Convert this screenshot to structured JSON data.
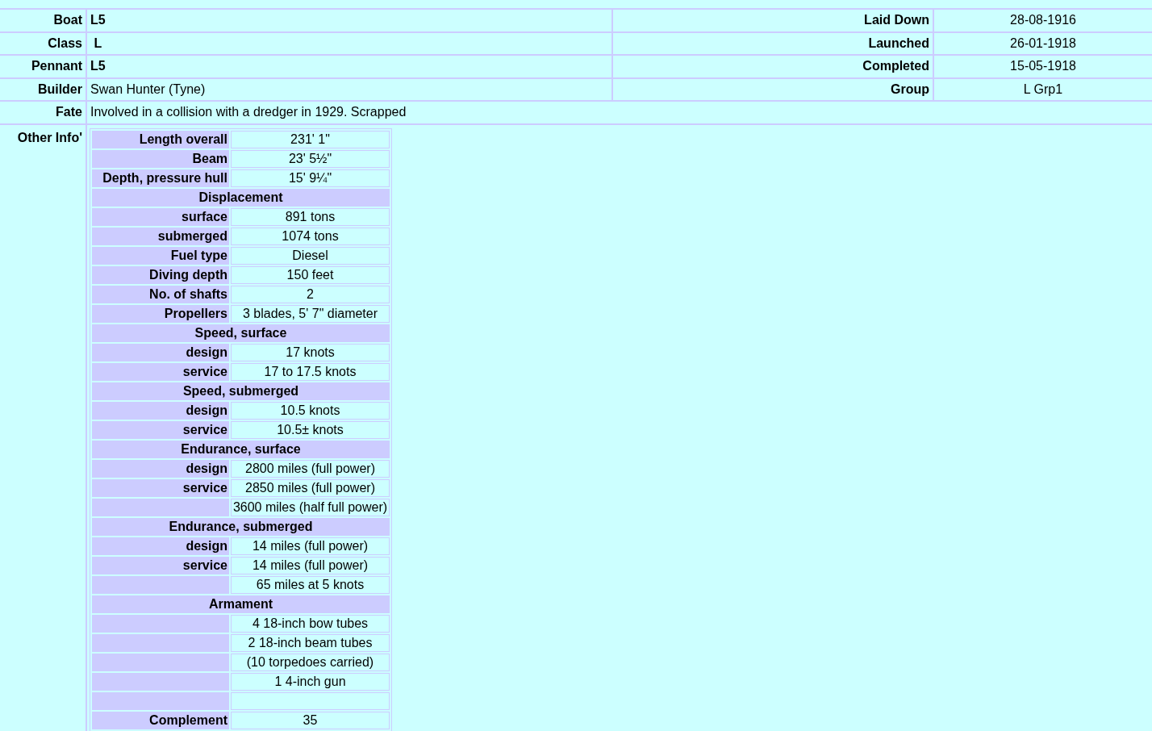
{
  "summary": [
    {
      "label": "Boat",
      "value": "L5",
      "bold": true,
      "label_2": "Laid Down",
      "value_2": "28-08-1916"
    },
    {
      "label": "Class",
      "value": " L",
      "bold": true,
      "label_2": "Launched",
      "value_2": "26-01-1918"
    },
    {
      "label": "Pennant",
      "value": "L5",
      "bold": true,
      "label_2": "Completed",
      "value_2": "15-05-1918"
    },
    {
      "label": "Builder",
      "value": "Swan Hunter (Tyne)",
      "bold": false,
      "label_2": "Group",
      "value_2": "L Grp1"
    }
  ],
  "fate": {
    "label": "Fate",
    "value": "Involved in a collision with a dredger in 1929. Scrapped"
  },
  "other_info": {
    "label": "Other Info'",
    "rows": [
      {
        "kind": "field",
        "label": "Length overall",
        "value": "231' 1\""
      },
      {
        "kind": "field",
        "label": "Beam",
        "value": "23' 5½\""
      },
      {
        "kind": "field",
        "label": "Depth, pressure hull",
        "value": "15' 9¼\""
      },
      {
        "kind": "header",
        "label": "Displacement"
      },
      {
        "kind": "field",
        "label": "surface",
        "value": "891 tons"
      },
      {
        "kind": "field",
        "label": "submerged",
        "value": "1074 tons"
      },
      {
        "kind": "field",
        "label": "Fuel type",
        "value": "Diesel"
      },
      {
        "kind": "field",
        "label": "Diving depth",
        "value": "150 feet"
      },
      {
        "kind": "field",
        "label": "No. of shafts",
        "value": "2"
      },
      {
        "kind": "field",
        "label": "Propellers",
        "value": "3 blades, 5' 7\" diameter"
      },
      {
        "kind": "header",
        "label": "Speed, surface"
      },
      {
        "kind": "field",
        "label": "design",
        "value": "17 knots"
      },
      {
        "kind": "field",
        "label": "service",
        "value": "17 to 17.5 knots"
      },
      {
        "kind": "header",
        "label": "Speed, submerged"
      },
      {
        "kind": "field",
        "label": "design",
        "value": "10.5 knots"
      },
      {
        "kind": "field",
        "label": "service",
        "value": "10.5± knots"
      },
      {
        "kind": "header",
        "label": "Endurance, surface"
      },
      {
        "kind": "field",
        "label": "design",
        "value": "2800 miles (full power)"
      },
      {
        "kind": "field",
        "label": "service",
        "value": "2850 miles (full power)"
      },
      {
        "kind": "value",
        "value": "3600 miles (half full power)"
      },
      {
        "kind": "header",
        "label": "Endurance, submerged"
      },
      {
        "kind": "field",
        "label": "design",
        "value": "14 miles (full power)"
      },
      {
        "kind": "field",
        "label": "service",
        "value": "14 miles (full power)"
      },
      {
        "kind": "value",
        "value": "65 miles at 5 knots"
      },
      {
        "kind": "header",
        "label": "Armament"
      },
      {
        "kind": "value",
        "value": "4 18-inch bow tubes"
      },
      {
        "kind": "value",
        "value": "2 18-inch beam tubes"
      },
      {
        "kind": "value",
        "value": "(10 torpedoes carried)"
      },
      {
        "kind": "value",
        "value": "1 4-inch gun"
      },
      {
        "kind": "blank"
      },
      {
        "kind": "field",
        "label": "Complement",
        "value": "35"
      }
    ]
  }
}
